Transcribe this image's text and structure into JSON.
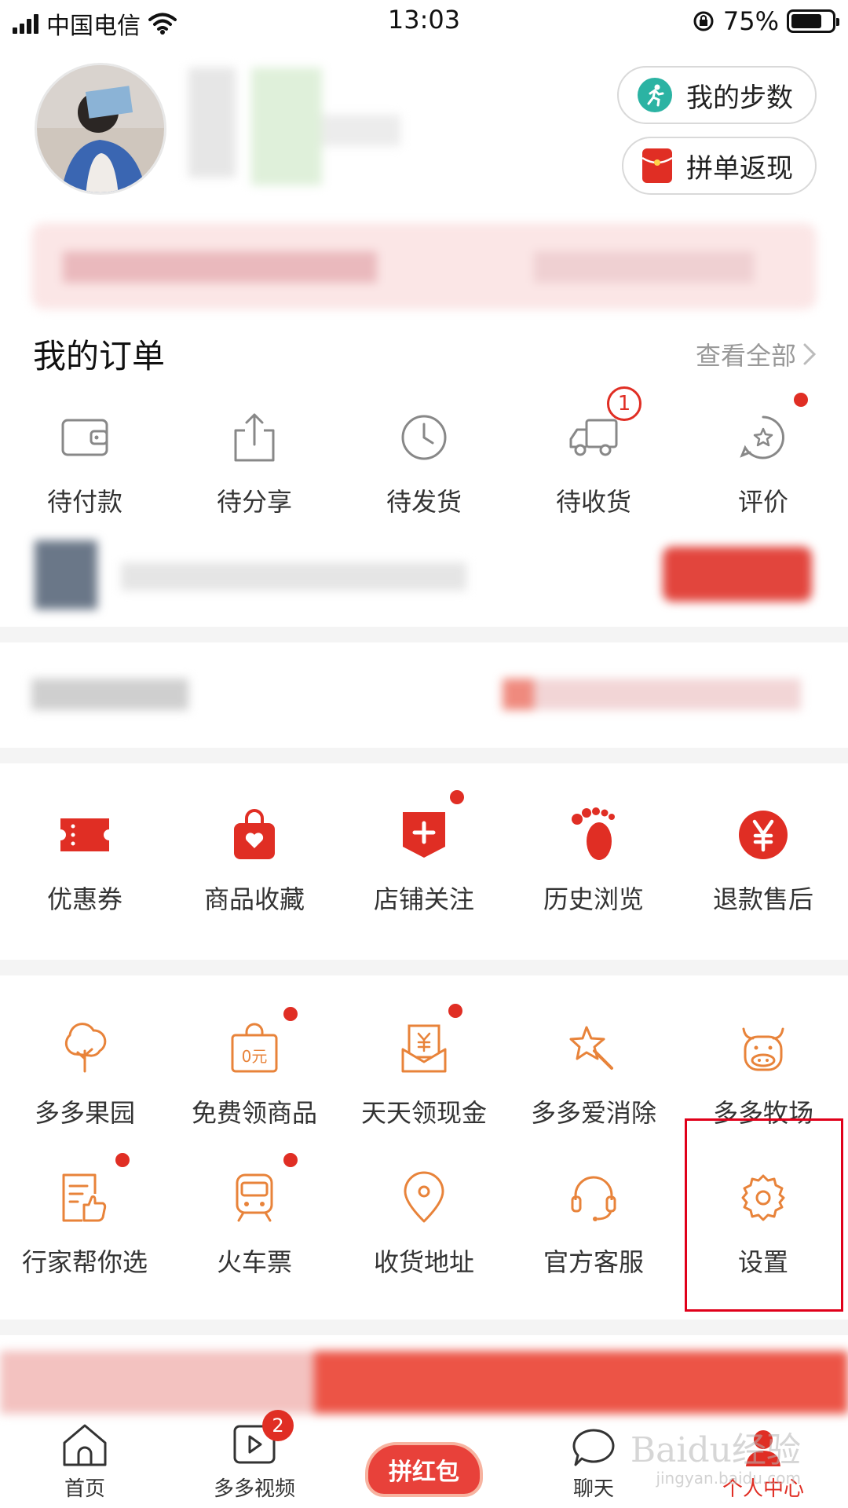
{
  "status_bar": {
    "carrier": "中国电信",
    "time": "13:03",
    "battery": "75%"
  },
  "profile": {
    "buttons": [
      {
        "label": "我的步数",
        "icon": "running-person-icon",
        "color": "#2bb3a3"
      },
      {
        "label": "拼单返现",
        "icon": "red-envelope-icon",
        "color": "#e02e24"
      }
    ]
  },
  "orders": {
    "title": "我的订单",
    "view_all": "查看全部",
    "items": [
      {
        "label": "待付款",
        "icon": "wallet-icon"
      },
      {
        "label": "待分享",
        "icon": "share-icon"
      },
      {
        "label": "待发货",
        "icon": "clock-icon"
      },
      {
        "label": "待收货",
        "icon": "truck-icon",
        "badge": "1"
      },
      {
        "label": "评价",
        "icon": "star-bubble-icon"
      }
    ]
  },
  "services": {
    "items": [
      {
        "label": "优惠券",
        "icon": "coupon-icon"
      },
      {
        "label": "商品收藏",
        "icon": "heart-bag-icon"
      },
      {
        "label": "店铺关注",
        "icon": "shop-follow-icon"
      },
      {
        "label": "历史浏览",
        "icon": "footprint-icon"
      },
      {
        "label": "退款售后",
        "icon": "yuan-icon"
      }
    ]
  },
  "tools": {
    "row1": [
      {
        "label": "多多果园",
        "icon": "tree-icon"
      },
      {
        "label": "免费领商品",
        "icon": "zero-yuan-bag-icon",
        "badge_text": "0元"
      },
      {
        "label": "天天领现金",
        "icon": "cash-envelope-icon"
      },
      {
        "label": "多多爱消除",
        "icon": "star-wand-icon"
      },
      {
        "label": "多多牧场",
        "icon": "cow-icon"
      }
    ],
    "row2": [
      {
        "label": "行家帮你选",
        "icon": "thumbs-up-doc-icon"
      },
      {
        "label": "火车票",
        "icon": "train-icon"
      },
      {
        "label": "收货地址",
        "icon": "location-pin-icon"
      },
      {
        "label": "官方客服",
        "icon": "headset-icon"
      },
      {
        "label": "设置",
        "icon": "gear-icon"
      }
    ]
  },
  "bottom_nav": {
    "items": [
      {
        "label": "首页",
        "icon": "home-icon"
      },
      {
        "label": "多多视频",
        "icon": "video-play-icon",
        "badge": "2"
      },
      {
        "label": "拼红包",
        "icon": "red-packet-icon"
      },
      {
        "label": "聊天",
        "icon": "chat-icon"
      },
      {
        "label": "个人中心",
        "icon": "person-icon",
        "active": true
      }
    ]
  },
  "watermark": {
    "brand": "Baidu经验",
    "url": "jingyan.baidu.com"
  },
  "colors": {
    "accent": "#e02e24",
    "tool_orange": "#e8833a"
  }
}
